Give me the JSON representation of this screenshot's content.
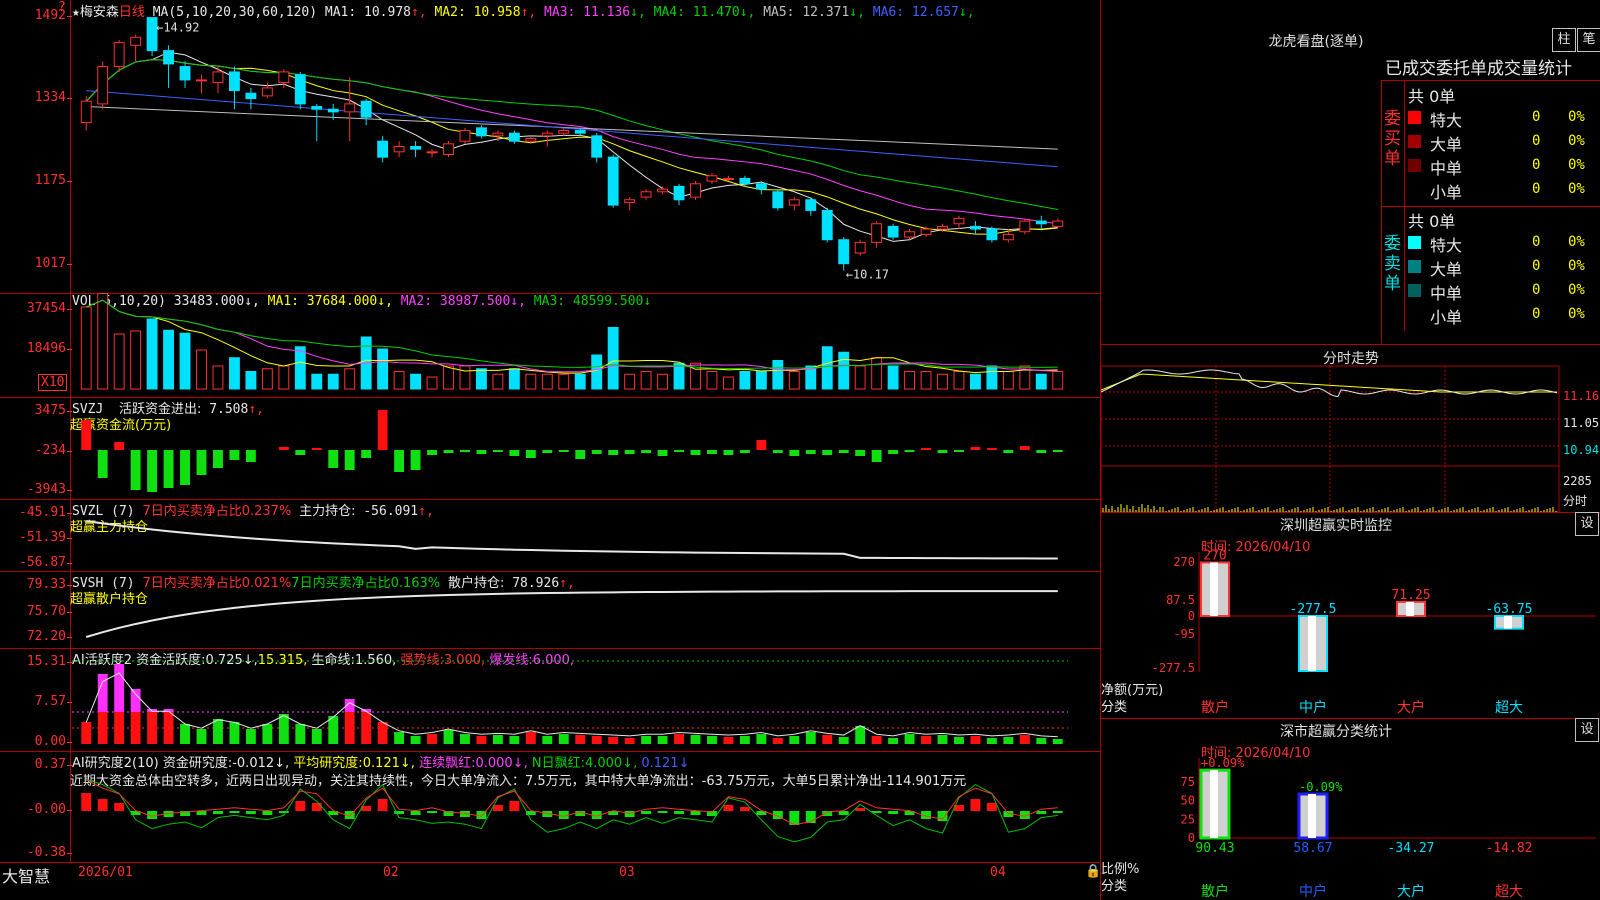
{
  "kline": {
    "star": "★",
    "name": "梅安森",
    "period": "日线",
    "ma_label": "MA(5,10,20,30,60,120)",
    "ma": [
      {
        "label": "MA1:",
        "value": "10.978",
        "arrow": "↑",
        "color": "#e8e8e8"
      },
      {
        "label": "MA2:",
        "value": "10.958",
        "arrow": "↑",
        "color": "#ffff00"
      },
      {
        "label": "MA3:",
        "value": "11.136",
        "arrow": "↓",
        "color": "#ff40ff"
      },
      {
        "label": "MA4:",
        "value": "11.470",
        "arrow": "↓",
        "color": "#00d000"
      },
      {
        "label": "MA5:",
        "value": "12.371",
        "arrow": "↓",
        "color": "#c0c0c0"
      },
      {
        "label": "MA6:",
        "value": "12.657",
        "arrow": "↓",
        "color": "#4060ff"
      }
    ],
    "ticks": [
      "1492",
      "1334",
      "1175",
      "1017"
    ],
    "high_note": "←14.92",
    "low_note": "←10.17",
    "corner": "?",
    "ylim": [
      9.9,
      15.1
    ],
    "candles": [
      [
        12.95,
        13.35,
        12.8,
        13.45
      ],
      [
        13.3,
        14.0,
        13.2,
        14.1
      ],
      [
        14.0,
        14.45,
        13.9,
        14.5
      ],
      [
        14.4,
        14.55,
        14.1,
        14.6
      ],
      [
        14.92,
        14.3,
        14.2,
        14.92
      ],
      [
        14.3,
        14.05,
        13.6,
        14.4
      ],
      [
        14.0,
        13.75,
        13.6,
        14.1
      ],
      [
        13.75,
        13.75,
        13.5,
        13.85
      ],
      [
        13.7,
        13.9,
        13.5,
        14.0
      ],
      [
        13.9,
        13.55,
        13.2,
        14.0
      ],
      [
        13.5,
        13.4,
        13.2,
        13.6
      ],
      [
        13.45,
        13.6,
        13.4,
        13.7
      ],
      [
        13.7,
        13.9,
        13.6,
        13.95
      ],
      [
        13.85,
        13.3,
        13.2,
        13.9
      ],
      [
        13.25,
        13.2,
        12.6,
        13.3
      ],
      [
        13.2,
        13.15,
        13.0,
        13.3
      ],
      [
        13.15,
        13.3,
        12.6,
        13.8
      ],
      [
        13.35,
        13.05,
        12.9,
        13.4
      ],
      [
        12.6,
        12.3,
        12.2,
        12.7
      ],
      [
        12.4,
        12.5,
        12.3,
        12.6
      ],
      [
        12.5,
        12.45,
        12.3,
        12.6
      ],
      [
        12.4,
        12.4,
        12.3,
        12.45
      ],
      [
        12.35,
        12.55,
        12.3,
        12.6
      ],
      [
        12.6,
        12.8,
        12.55,
        12.85
      ],
      [
        12.85,
        12.7,
        12.65,
        12.9
      ],
      [
        12.7,
        12.75,
        12.6,
        12.8
      ],
      [
        12.75,
        12.6,
        12.55,
        12.8
      ],
      [
        12.6,
        12.65,
        12.55,
        12.7
      ],
      [
        12.7,
        12.75,
        12.5,
        12.8
      ],
      [
        12.75,
        12.8,
        12.7,
        12.85
      ],
      [
        12.8,
        12.75,
        12.7,
        12.85
      ],
      [
        12.7,
        12.3,
        12.2,
        12.75
      ],
      [
        12.3,
        11.4,
        11.35,
        12.35
      ],
      [
        11.45,
        11.5,
        11.3,
        11.55
      ],
      [
        11.55,
        11.65,
        11.5,
        11.7
      ],
      [
        11.65,
        11.7,
        11.6,
        11.75
      ],
      [
        11.75,
        11.5,
        11.4,
        11.8
      ],
      [
        11.55,
        11.8,
        11.5,
        11.85
      ],
      [
        11.85,
        11.95,
        11.8,
        12.0
      ],
      [
        11.9,
        11.9,
        11.85,
        11.95
      ],
      [
        11.9,
        11.8,
        11.75,
        11.95
      ],
      [
        11.8,
        11.7,
        11.6,
        11.85
      ],
      [
        11.65,
        11.35,
        11.3,
        11.7
      ],
      [
        11.4,
        11.5,
        11.3,
        11.55
      ],
      [
        11.5,
        11.3,
        11.2,
        11.55
      ],
      [
        11.3,
        10.75,
        10.7,
        11.35
      ],
      [
        10.75,
        10.3,
        10.17,
        10.8
      ],
      [
        10.5,
        10.7,
        10.45,
        10.75
      ],
      [
        10.7,
        11.05,
        10.6,
        11.1
      ],
      [
        11.0,
        10.8,
        10.75,
        11.05
      ],
      [
        10.8,
        10.9,
        10.75,
        10.95
      ],
      [
        10.85,
        10.95,
        10.8,
        11.0
      ],
      [
        10.95,
        11.0,
        10.9,
        11.05
      ],
      [
        11.05,
        11.15,
        10.95,
        11.2
      ],
      [
        11.0,
        10.95,
        10.85,
        11.1
      ],
      [
        10.95,
        10.75,
        10.7,
        11.0
      ],
      [
        10.75,
        10.85,
        10.7,
        10.95
      ],
      [
        10.9,
        11.1,
        10.85,
        11.15
      ],
      [
        11.1,
        11.05,
        10.95,
        11.2
      ],
      [
        11.0,
        11.1,
        10.95,
        11.15
      ]
    ]
  },
  "vol": {
    "label": "VOL(5,10,20)",
    "value": "33483.000↓,",
    "ma": [
      {
        "label": "MA1:",
        "value": "37684.000↓,",
        "color": "#ffff00"
      },
      {
        "label": "MA2:",
        "value": "38987.500↓,",
        "color": "#ff40ff"
      },
      {
        "label": "MA3:",
        "value": "48599.500↓",
        "color": "#00d000"
      }
    ],
    "ticks": [
      "37454",
      "18496"
    ],
    "unit": "X10"
  },
  "svzj": {
    "label": "SVZJ",
    "desc": "活跃资金进出:",
    "value": "7.508",
    "arrow": "↑,",
    "sub": "超赢资金流(万元)",
    "ticks": [
      "3475",
      "-234",
      "-3943"
    ]
  },
  "svzl": {
    "label": "SVZL (7)",
    "desc": "7日内买卖净占比0.237%",
    "hold": "主力持仓:",
    "value": "-56.091",
    "arrow": "↑,",
    "sub": "超赢主力持仓",
    "ticks": [
      "-45.91",
      "-51.39",
      "-56.87"
    ]
  },
  "svsh": {
    "label": "SVSH (7)",
    "desc1": "7日内买卖净占比0.021%",
    "desc2": "7日内买卖净占比0.163%",
    "hold": "散户持仓:",
    "value": "78.926",
    "arrow": "↑,",
    "sub": "超赢散户持仓",
    "ticks": [
      "79.33",
      "75.70",
      "72.20"
    ]
  },
  "ai1": {
    "label": "AI活跃度2",
    "a": "资金活跃度:",
    "a_v": "0.725↓,",
    "b": "15.315,",
    "c": "生命线:",
    "c_v": "1.560,",
    "d": "强势线:",
    "d_v": "3.000,",
    "e": "爆发线:",
    "e_v": "6.000,",
    "ticks": [
      "15.31",
      "7.57",
      "0.00"
    ]
  },
  "ai2": {
    "label": "AI研究度2(10)",
    "a": "资金研究度:",
    "a_v": "-0.012↓,",
    "b": "平均研究度:",
    "b_v": "0.121↓,",
    "c": "连续飘红:",
    "c_v": "0.000↓,",
    "d": "N日飘红:",
    "d_v": "4.000↓,",
    "e": "0.121↓",
    "comment": "近期大资金总体由空转多，近两日出现异动，关注其持续性，今日大单净流入：7.5万元，其中特大单净流出：-63.75万元，大单5日累计净出-114.901万元",
    "ticks": [
      "0.37",
      "-0.00",
      "-0.38"
    ]
  },
  "xaxis": {
    "brand": "大智慧",
    "labels": [
      "2026/01",
      "02",
      "03",
      "04"
    ]
  },
  "lhb": {
    "title": "龙虎看盘(逐单)",
    "btn1": "柱",
    "btn2": "笔",
    "tabs": "已成交委托单成交量统计",
    "buy": {
      "side": "委买单",
      "total": "共 0单",
      "rows": [
        {
          "name": "特大",
          "qty": "0",
          "pct": "0%",
          "color": "#ff0000"
        },
        {
          "name": "大单",
          "qty": "0",
          "pct": "0%",
          "color": "#a00000"
        },
        {
          "name": "中单",
          "qty": "0",
          "pct": "0%",
          "color": "#700000"
        },
        {
          "name": "小单",
          "qty": "0",
          "pct": "0%",
          "color": ""
        }
      ]
    },
    "sell": {
      "side": "委卖单",
      "total": "共 0单",
      "rows": [
        {
          "name": "特大",
          "qty": "0",
          "pct": "0%",
          "color": "#00ffff"
        },
        {
          "name": "大单",
          "qty": "0",
          "pct": "0%",
          "color": "#008080"
        },
        {
          "name": "中单",
          "qty": "0",
          "pct": "0%",
          "color": "#006060"
        },
        {
          "name": "小单",
          "qty": "0",
          "pct": "0%",
          "color": ""
        }
      ]
    }
  },
  "fenshi": {
    "title": "分时走势",
    "ticks": [
      "11.16",
      "11.05",
      "10.94",
      "2285",
      "分时"
    ]
  },
  "sz_monitor": {
    "title": "深圳超赢实时监控",
    "btn": "设",
    "date": "时间: 2026/04/10",
    "ylabel": "净额(万元)",
    "xlabel": "分类",
    "ticks": [
      "270",
      "87.5",
      "0",
      "-95",
      "-277.5"
    ],
    "chart_data": {
      "type": "bar",
      "categories": [
        "散户",
        "中户",
        "大户",
        "超大"
      ],
      "values": [
        270,
        -277.5,
        71.25,
        -63.75
      ],
      "labels": [
        "270",
        "-277.5",
        "71.25",
        "-63.75"
      ],
      "ylim": [
        -277.5,
        270
      ]
    }
  },
  "sz_class": {
    "title": "深市超赢分类统计",
    "btn": "设",
    "date": "时间: 2026/04/10",
    "ylabel": "比例%",
    "xlabel": "分类",
    "ticks": [
      "75",
      "50",
      "25",
      "0"
    ],
    "chart_data": {
      "type": "bar",
      "categories": [
        "散户",
        "中户",
        "大户",
        "超大"
      ],
      "values": [
        90.43,
        58.67,
        -34.27,
        -14.82
      ],
      "top_labels": [
        "+0.09%",
        "-0.09%",
        "",
        ""
      ],
      "ylim": [
        0,
        100
      ]
    }
  },
  "colors": {
    "up": "#ff3030",
    "down": "#00e0ff",
    "grid": "#b00000"
  }
}
